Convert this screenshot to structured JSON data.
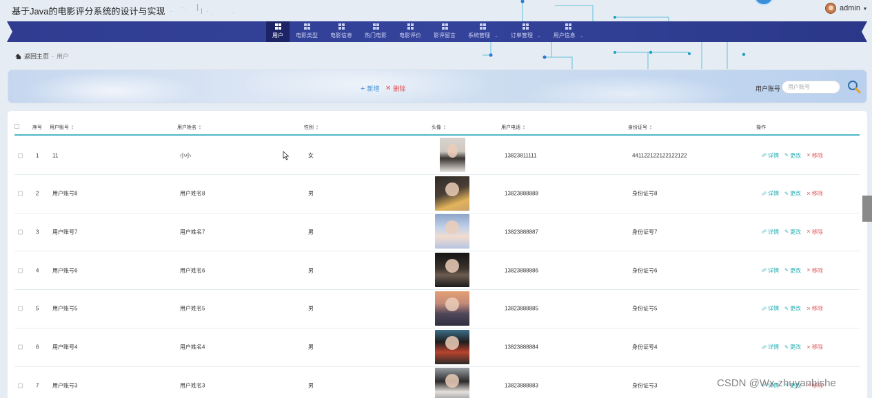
{
  "app": {
    "title": "基于Java的电影评分系统的设计与实现",
    "user": "admin",
    "user_caret": "▾"
  },
  "nav": {
    "items": [
      {
        "label": "用户",
        "active": true,
        "caret": false
      },
      {
        "label": "电影类型",
        "active": false,
        "caret": false
      },
      {
        "label": "电影信息",
        "active": false,
        "caret": false
      },
      {
        "label": "热门电影",
        "active": false,
        "caret": false
      },
      {
        "label": "电影评价",
        "active": false,
        "caret": false
      },
      {
        "label": "影评留言",
        "active": false,
        "caret": false
      },
      {
        "label": "系统管理",
        "active": false,
        "caret": true
      },
      {
        "label": "订单管理",
        "active": false,
        "caret": true
      },
      {
        "label": "用户信息",
        "active": false,
        "caret": true
      }
    ]
  },
  "breadcrumb": {
    "home": "返回主页",
    "sep": "-",
    "current": "用户"
  },
  "toolbar": {
    "add_label": "新增",
    "delete_label": "删除",
    "search_label": "用户账号",
    "search_placeholder": "用户账号"
  },
  "table": {
    "headers": {
      "index": "序号",
      "account": "用户账号",
      "name": "用户姓名",
      "gender": "性别",
      "avatar": "头像",
      "phone": "用户电话",
      "idcard": "身份证号",
      "actions": "操作"
    },
    "row_actions": {
      "detail": "详情",
      "edit": "更改",
      "remove": "移除"
    },
    "rows": [
      {
        "index": "1",
        "account": "11",
        "name": "小小",
        "gender": "女",
        "phone": "13823811111",
        "idcard": "441122122122122122",
        "photo": "photo-girl-plaid"
      },
      {
        "index": "2",
        "account": "用户账号8",
        "name": "用户姓名8",
        "gender": "男",
        "phone": "13823888888",
        "idcard": "身份证号8",
        "photo": "photo-boy-yellow"
      },
      {
        "index": "3",
        "account": "用户账号7",
        "name": "用户姓名7",
        "gender": "男",
        "phone": "13823888887",
        "idcard": "身份证号7",
        "photo": "photo-girl-blue"
      },
      {
        "index": "4",
        "account": "用户账号6",
        "name": "用户姓名6",
        "gender": "男",
        "phone": "13823888886",
        "idcard": "身份证号6",
        "photo": "photo-boy-dark"
      },
      {
        "index": "5",
        "account": "用户账号5",
        "name": "用户姓名5",
        "gender": "男",
        "phone": "13823888885",
        "idcard": "身份证号5",
        "photo": "photo-girl-sunset"
      },
      {
        "index": "6",
        "account": "用户账号4",
        "name": "用户姓名4",
        "gender": "男",
        "phone": "13823888884",
        "idcard": "身份证号4",
        "photo": "photo-boy-scarf"
      },
      {
        "index": "7",
        "account": "用户账号3",
        "name": "用户姓名3",
        "gender": "男",
        "phone": "13823888883",
        "idcard": "身份证号3",
        "photo": "photo-boy-grey"
      }
    ]
  },
  "watermark": "CSDN @Wx-zhuyanbishe",
  "colors": {
    "nav_band": "#2e3a8c",
    "nav_active": "#1c2466",
    "accent_teal": "#4fb6c8",
    "add_blue": "#3c8dd6",
    "danger_red": "#e24b4b"
  }
}
